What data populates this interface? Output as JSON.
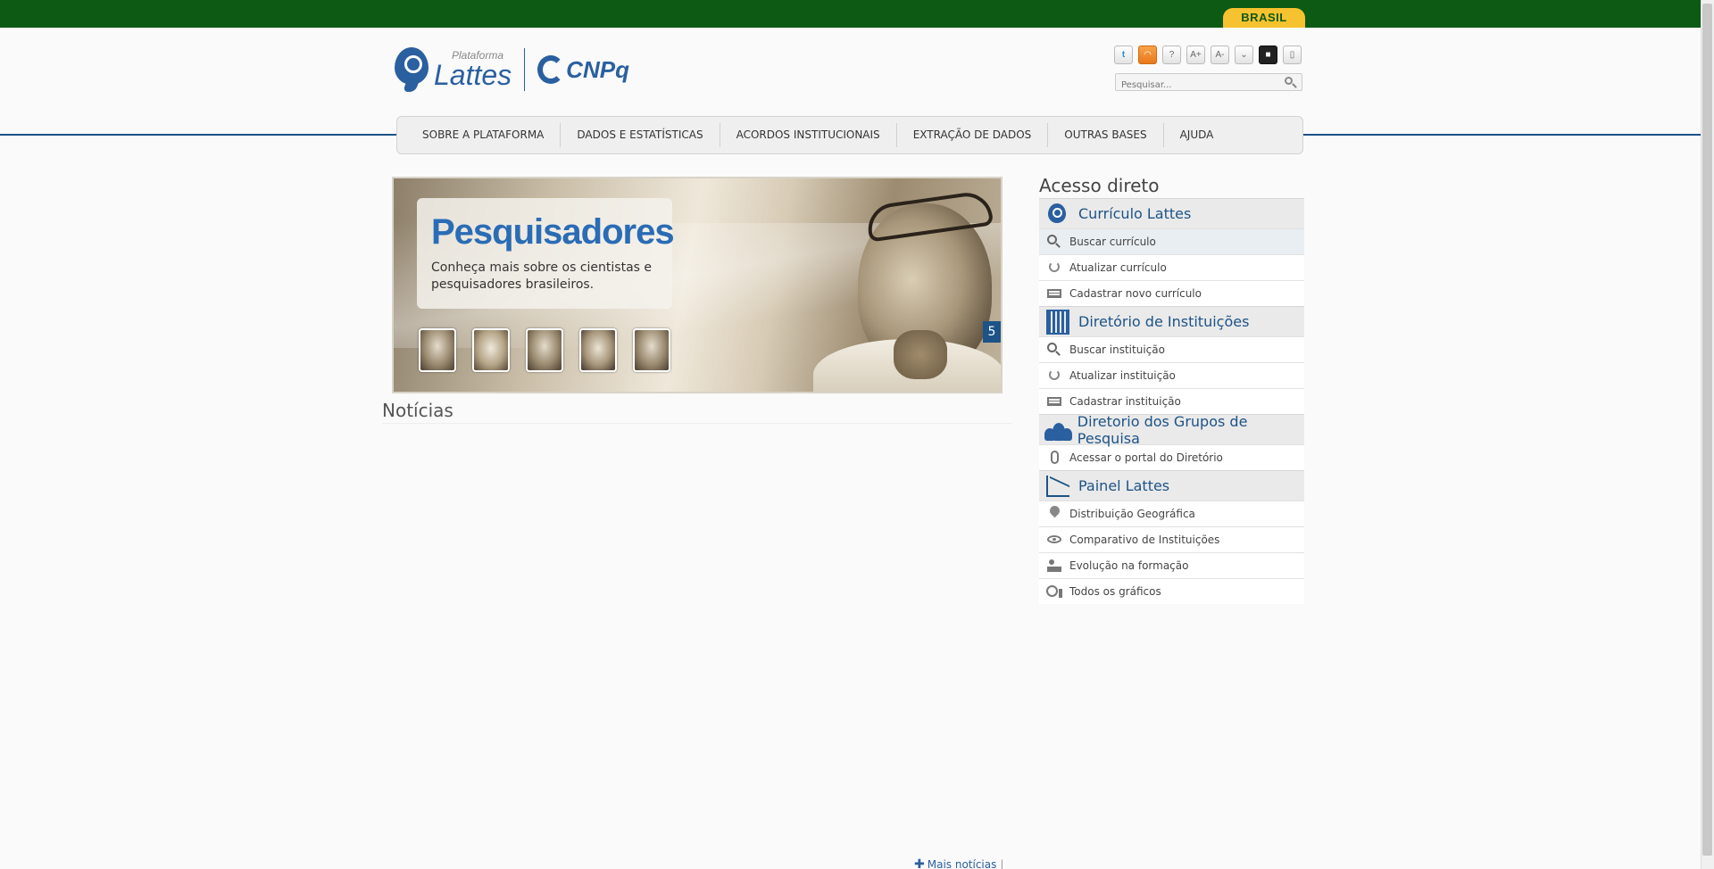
{
  "gov_bar": {
    "brasil_label": "BRASIL"
  },
  "header": {
    "logo_small": "Plataforma",
    "logo_big": "Lattes",
    "cnpq_label": "CNPq",
    "tools": [
      {
        "icon": "twitter-icon",
        "glyph": "t"
      },
      {
        "icon": "rss-icon",
        "glyph": "◠"
      },
      {
        "icon": "help-icon",
        "glyph": "?"
      },
      {
        "icon": "font-increase-icon",
        "glyph": "A+"
      },
      {
        "icon": "font-decrease-icon",
        "glyph": "A-"
      },
      {
        "icon": "chevron-down-icon",
        "glyph": "⌄"
      },
      {
        "icon": "contrast-icon",
        "glyph": "■"
      },
      {
        "icon": "lock-icon",
        "glyph": "▯"
      }
    ],
    "search_placeholder": "Pesquisar..."
  },
  "nav": {
    "items": [
      "SOBRE A PLATAFORMA",
      "DADOS E ESTATÍSTICAS",
      "ACORDOS INSTITUCIONAIS",
      "EXTRAÇÃO DE DADOS",
      "OUTRAS BASES",
      "AJUDA"
    ]
  },
  "banner": {
    "title": "Pesquisadores",
    "subtitle_line1": "Conheça mais sobre os cientistas e",
    "subtitle_line2": "pesquisadores brasileiros.",
    "slide_number": "5"
  },
  "news": {
    "title": "Notícias",
    "more_label": "Mais notícias",
    "more_sep": "|"
  },
  "sidebar": {
    "title": "Acesso direto",
    "sections": [
      {
        "label": "Currículo Lattes",
        "icon": "lattes-icon",
        "items": [
          {
            "label": "Buscar currículo",
            "icon": "search-icon"
          },
          {
            "label": "Atualizar currículo",
            "icon": "refresh-icon"
          },
          {
            "label": "Cadastrar novo currículo",
            "icon": "card-icon"
          }
        ]
      },
      {
        "label": "Diretório de Instituições",
        "icon": "building-icon",
        "items": [
          {
            "label": "Buscar instituição",
            "icon": "search-icon"
          },
          {
            "label": "Atualizar instituição",
            "icon": "refresh-icon"
          },
          {
            "label": "Cadastrar instituição",
            "icon": "card-icon"
          }
        ]
      },
      {
        "label": "Diretorio dos Grupos de Pesquisa",
        "icon": "group-icon",
        "items": [
          {
            "label": "Acessar o portal do Diretório",
            "icon": "mouse-icon"
          }
        ]
      },
      {
        "label": "Painel Lattes",
        "icon": "chart-icon",
        "items": [
          {
            "label": "Distribuição Geográfica",
            "icon": "pin-icon"
          },
          {
            "label": "Comparativo de Instituições",
            "icon": "eye-icon"
          },
          {
            "label": "Evolução na formação",
            "icon": "evolution-icon"
          },
          {
            "label": "Todos os gráficos",
            "icon": "graphs-icon"
          }
        ]
      }
    ]
  }
}
